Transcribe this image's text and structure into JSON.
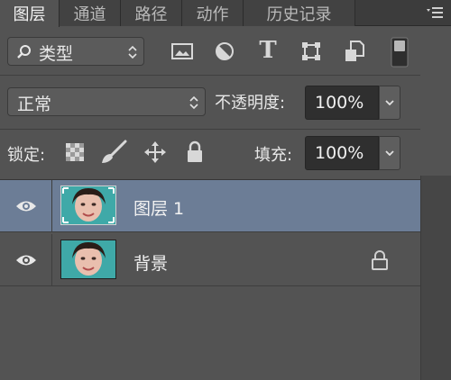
{
  "tabs": [
    {
      "label": "图层",
      "active": true
    },
    {
      "label": "通道",
      "active": false
    },
    {
      "label": "路径",
      "active": false
    },
    {
      "label": "动作",
      "active": false
    },
    {
      "label": "历史记录",
      "active": false
    }
  ],
  "filter": {
    "kind_label": "类型",
    "icons": [
      "image-filter-icon",
      "adjustment-filter-icon",
      "type-filter-icon",
      "shape-filter-icon",
      "smart-object-filter-icon",
      "filter-toggle-icon"
    ]
  },
  "blend": {
    "mode": "正常",
    "opacity_label": "不透明度:",
    "opacity_value": "100%"
  },
  "lock": {
    "label": "锁定:",
    "icons": [
      "lock-transparent-icon",
      "lock-image-icon",
      "lock-position-icon",
      "lock-all-icon"
    ],
    "fill_label": "填充:",
    "fill_value": "100%"
  },
  "layers": [
    {
      "name": "图层 1",
      "visible": true,
      "selected": true,
      "locked": false
    },
    {
      "name": "背景",
      "visible": true,
      "selected": false,
      "locked": true
    }
  ],
  "colors": {
    "panel": "#535353",
    "selected_row": "#6c7d96",
    "field": "#2f2f2f"
  }
}
